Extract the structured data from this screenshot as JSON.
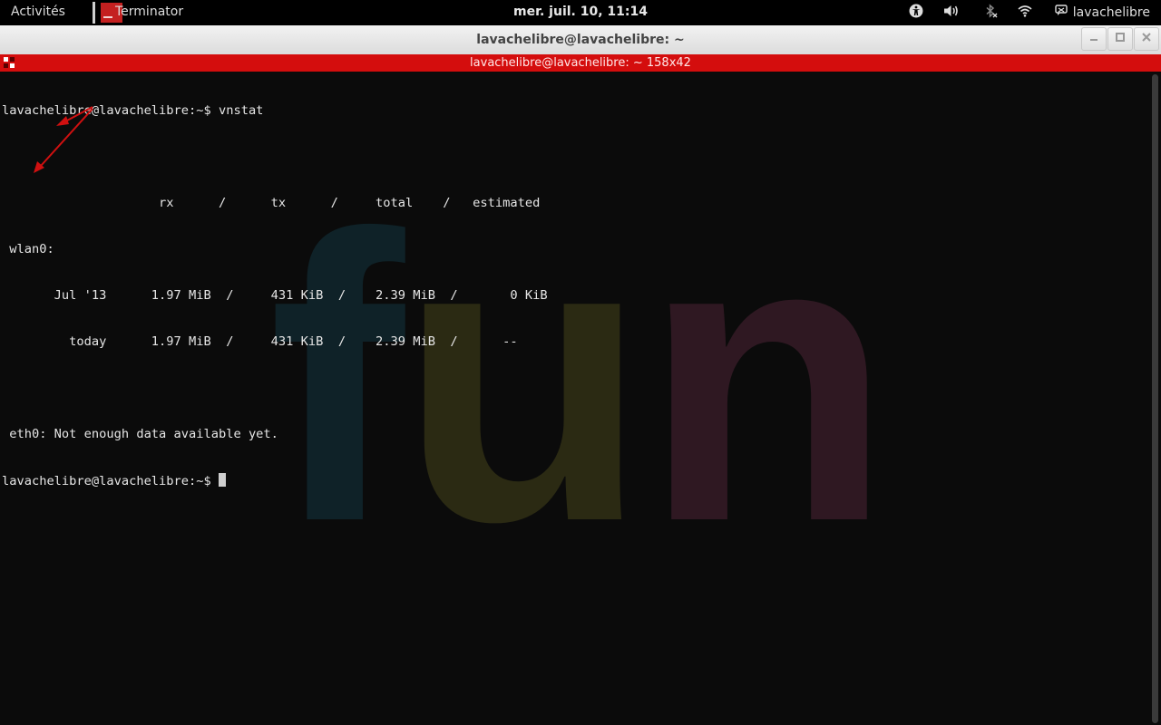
{
  "topbar": {
    "activities": "Activités",
    "app_name": "Terminator",
    "clock": "mer. juil. 10, 11:14",
    "tray_icons": [
      "accessibility-icon",
      "volume-icon",
      "bluetooth-off-icon",
      "wifi-icon"
    ],
    "user": "lavachelibre"
  },
  "window": {
    "title": "lavachelibre@lavachelibre: ~",
    "controls": [
      "minimize",
      "maximize",
      "close"
    ]
  },
  "terminator": {
    "title": "lavachelibre@lavachelibre: ~ 158x42"
  },
  "terminal": {
    "lines": [
      "lavachelibre@lavachelibre:~$ vnstat",
      "",
      "                     rx      /      tx      /     total    /   estimated",
      " wlan0:",
      "       Jul '13      1.97 MiB  /     431 KiB  /    2.39 MiB  /       0 KiB",
      "         today      1.97 MiB  /     431 KiB  /    2.39 MiB  /      --",
      "",
      " eth0: Not enough data available yet.",
      "lavachelibre@lavachelibre:~$ "
    ],
    "background_text": [
      "f",
      "u",
      "n"
    ]
  },
  "colors": {
    "topbar": "#000000",
    "terminator_bar": "#d40d0d",
    "terminal_bg": "#0b0b0b",
    "arrow": "#d01010"
  }
}
